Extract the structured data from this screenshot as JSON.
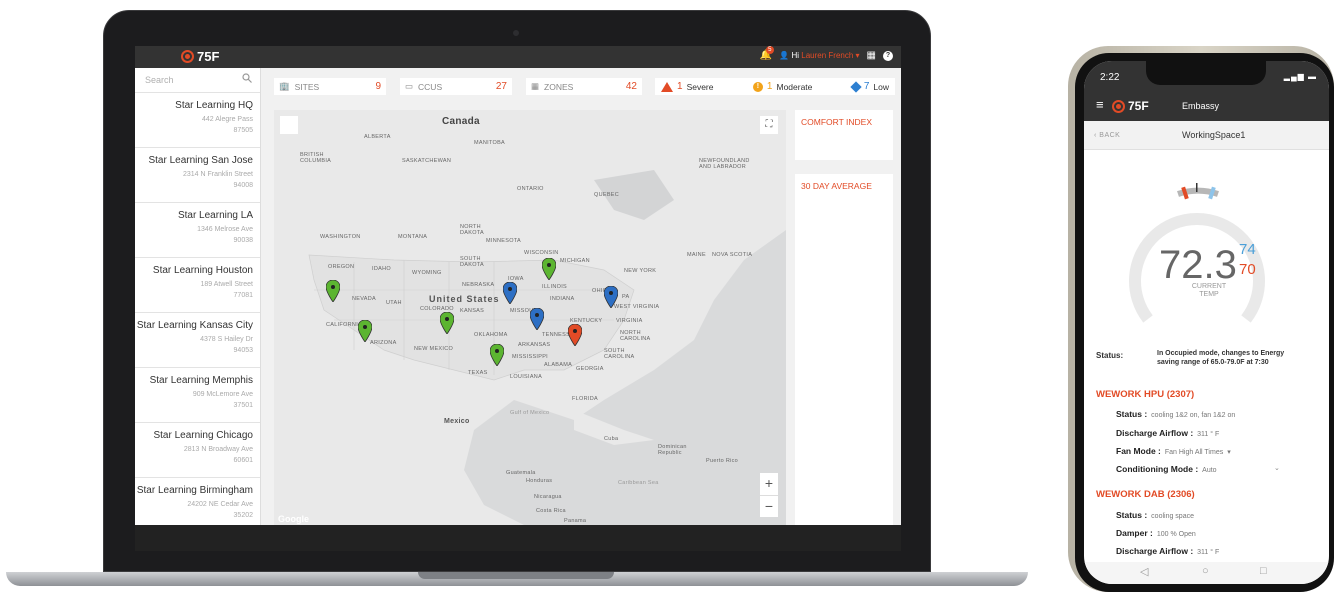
{
  "app": {
    "logo_text": "75F"
  },
  "topbar": {
    "notification_count": "5",
    "greeting": "Hi",
    "user_name": "Lauren French"
  },
  "sidebar": {
    "search_placeholder": "Search",
    "sites": [
      {
        "name": "Star Learning HQ",
        "street": "442  Alegre Pass",
        "zip": "87505"
      },
      {
        "name": "Star Learning San Jose",
        "street": "2314 N  Franklin Street",
        "zip": "94008"
      },
      {
        "name": "Star Learning LA",
        "street": "1346  Melrose Ave",
        "zip": "90038"
      },
      {
        "name": "Star Learning Houston",
        "street": "189  Atwell Street",
        "zip": "77081"
      },
      {
        "name": "Star Learning Kansas City",
        "street": "4378 S  Hailey Dr",
        "zip": "94053"
      },
      {
        "name": "Star Learning Memphis",
        "street": "909 McLemore Ave",
        "zip": "37501"
      },
      {
        "name": "Star Learning Chicago",
        "street": "2813 N Broadway Ave",
        "zip": "60601"
      },
      {
        "name": "Star Learning Birmingham",
        "street": "24202 NE Cedar Ave",
        "zip": "35202"
      }
    ]
  },
  "stats": {
    "sites_label": "SITES",
    "sites_count": "9",
    "ccus_label": "CCUS",
    "ccus_count": "27",
    "zones_label": "ZONES",
    "zones_count": "42"
  },
  "alerts": {
    "severe_count": "1",
    "severe_label": "Severe",
    "moderate_count": "1",
    "moderate_label": "Moderate",
    "low_count": "7",
    "low_label": "Low",
    "colors": {
      "severe": "#e24b26",
      "moderate": "#f2a31a",
      "low": "#2d7fd1"
    }
  },
  "map": {
    "labels": {
      "canada": "Canada",
      "alberta": "ALBERTA",
      "manitoba": "MANITOBA",
      "british_columbia": "BRITISH COLUMBIA",
      "saskatchewan": "SASKATCHEWAN",
      "ontario": "ONTARIO",
      "quebec": "QUEBEC",
      "newfoundland": "NEWFOUNDLAND AND LABRADOR",
      "washington": "WASHINGTON",
      "montana": "MONTANA",
      "north_dakota": "NORTH DAKOTA",
      "minnesota": "MINNESOTA",
      "oregon": "OREGON",
      "idaho": "IDAHO",
      "wyoming": "WYOMING",
      "south_dakota": "SOUTH DAKOTA",
      "wisconsin": "WISCONSIN",
      "michigan": "MICHIGAN",
      "new_york": "NEW YORK",
      "maine": "MAINE",
      "nova_scotia": "NOVA SCOTIA",
      "nevada": "NEVADA",
      "utah": "UTAH",
      "colorado": "COLORADO",
      "nebraska": "NEBRASKA",
      "iowa": "IOWA",
      "illinois": "ILLINOIS",
      "indiana": "INDIANA",
      "ohio": "OHIO",
      "pa": "PA",
      "united_states": "United States",
      "kansas": "KANSAS",
      "missouri": "MISSOURI",
      "kentucky": "KENTUCKY",
      "west_virginia": "WEST VIRGINIA",
      "virginia": "VIRGINIA",
      "california": "CALIFORNIA",
      "arizona": "ARIZONA",
      "new_mexico": "NEW MEXICO",
      "oklahoma": "OKLAHOMA",
      "tennessee": "TENNESSEE",
      "north_carolina": "NORTH CAROLINA",
      "arkansas": "ARKANSAS",
      "south_carolina": "SOUTH CAROLINA",
      "mississippi": "MISSISSIPPI",
      "alabama": "ALABAMA",
      "georgia": "GEORGIA",
      "texas": "TEXAS",
      "louisiana": "LOUISIANA",
      "florida": "FLORIDA",
      "mexico": "Mexico",
      "gulf": "Gulf of Mexico",
      "cuba": "Cuba",
      "dominican": "Dominican Republic",
      "puerto_rico": "Puerto Rico",
      "guatemala": "Guatemala",
      "honduras": "Honduras",
      "nicaragua": "Nicaragua",
      "caribbean": "Caribbean Sea",
      "costa_rica": "Costa Rica",
      "panama": "Panama",
      "google": "Google"
    },
    "pins": [
      {
        "status": "green"
      },
      {
        "status": "green"
      },
      {
        "status": "green"
      },
      {
        "status": "green"
      },
      {
        "status": "green"
      },
      {
        "status": "blue"
      },
      {
        "status": "blue"
      },
      {
        "status": "blue"
      },
      {
        "status": "red"
      }
    ],
    "pin_colors": {
      "green": "#5cb531",
      "blue": "#2d6fc4",
      "red": "#e24b26"
    }
  },
  "panels": {
    "comfort_title": "COMFORT INDEX",
    "avg_title": "30 DAY AVERAGE"
  },
  "phone": {
    "time": "2:22",
    "site": "Embassy",
    "back_label": "BACK",
    "space": "WorkingSpace1",
    "current_temp": "72.3",
    "heat_setpoint": "74",
    "cool_setpoint": "70",
    "temp_caption": "CURRENT TEMP",
    "status_label": "Status:",
    "status_text": "In Occupied mode, changes to Energy saving range of 65.0-79.0F at 7:30",
    "hpu": {
      "title": "WEWORK HPU (2307)",
      "status_label": "Status :",
      "status_value": "cooling 1&2 on, fan 1&2 on",
      "airflow_label": "Discharge Airflow :",
      "airflow_value": "311 ° F",
      "fan_label": "Fan Mode :",
      "fan_value": "Fan High All Times",
      "cond_label": "Conditioning Mode :",
      "cond_value": "Auto"
    },
    "dab": {
      "title": "WEWORK DAB (2306)",
      "status_label": "Status :",
      "status_value": "cooling space",
      "damper_label": "Damper :",
      "damper_value": "100 % Open",
      "airflow_label": "Discharge Airflow :",
      "airflow_value": "311 ° F"
    }
  }
}
